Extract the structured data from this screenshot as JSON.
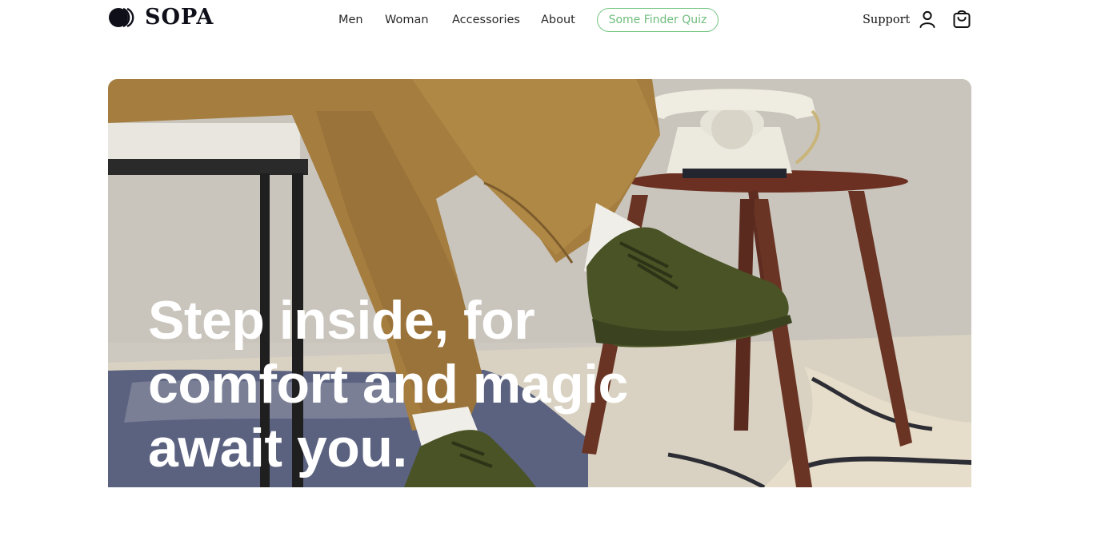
{
  "header": {
    "brand": "SOPA",
    "logo_icon": "double-circle-logo",
    "nav": [
      {
        "label": "Men"
      },
      {
        "label": "Woman"
      },
      {
        "label": "Accessories"
      },
      {
        "label": "About"
      }
    ],
    "quiz_label": "Some Finder Quiz",
    "support_label": "Support",
    "account_icon": "user-icon",
    "cart_icon": "shopping-bag-icon"
  },
  "hero": {
    "headline_lines": [
      "Step inside, for",
      "comfort and magic",
      "await you."
    ],
    "image": "person-sitting-green-knit-sneakers-rotary-phone"
  },
  "colors": {
    "accent_green": "#6fbd7c",
    "brand_dark": "#0f0f1a",
    "headline": "#ffffff"
  }
}
